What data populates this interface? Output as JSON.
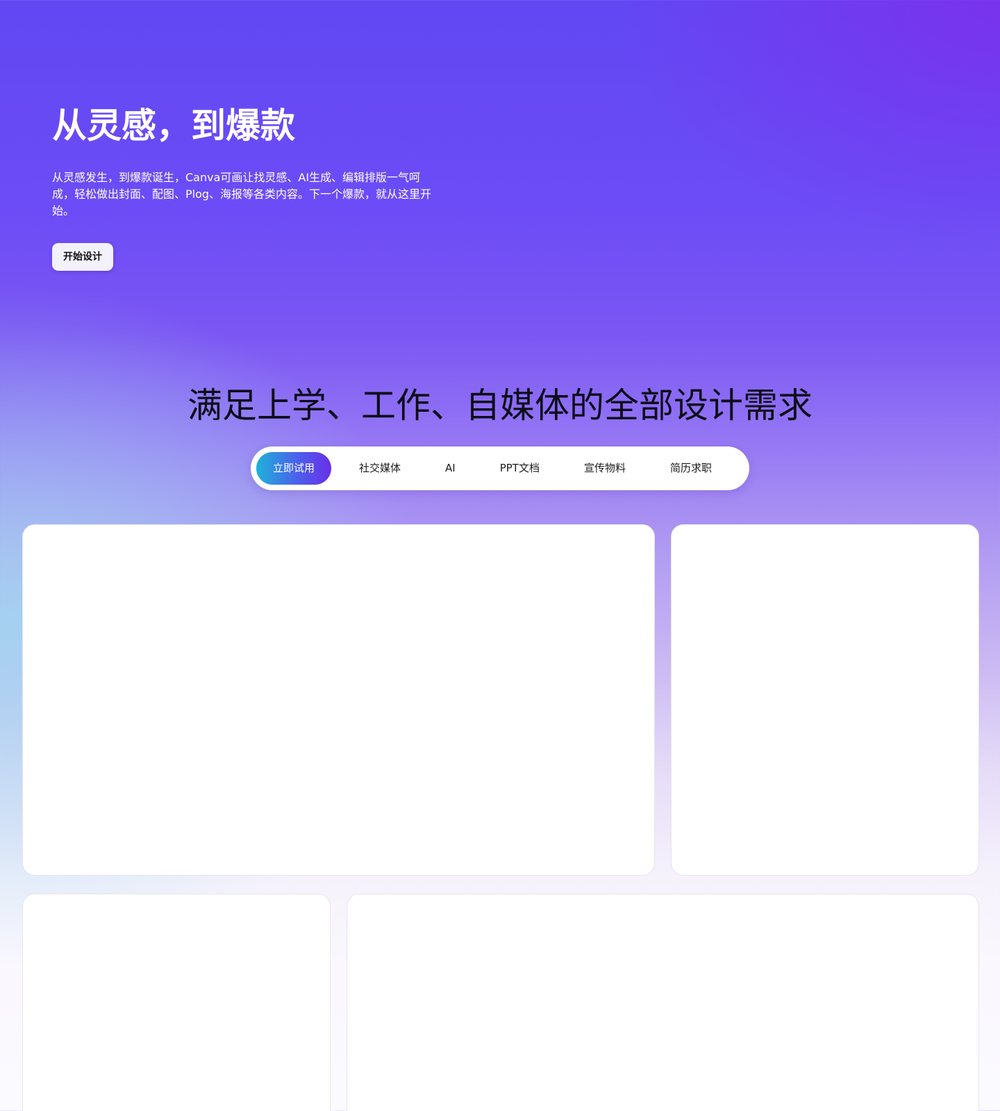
{
  "hero": {
    "title": "从灵感，到爆款",
    "subtitle": "从灵感发生，到爆款诞生，Canva可画让找灵感、AI生成、编辑排版一气呵成，轻松做出封面、配图、Plog、海报等各类内容。下一个爆款，就从这里开始。",
    "button_label": "开始设计"
  },
  "section": {
    "title": "满足上学、工作、自媒体的全部设计需求"
  },
  "tabs": [
    {
      "label": "立即试用",
      "active": true
    },
    {
      "label": "社交媒体",
      "active": false
    },
    {
      "label": "AI",
      "active": false
    },
    {
      "label": "PPT文档",
      "active": false
    },
    {
      "label": "宣传物料",
      "active": false
    },
    {
      "label": "简历求职",
      "active": false
    }
  ],
  "colors": {
    "tab_active_start": "#1fb1d9",
    "tab_active_end": "#6a2fe8",
    "hero_bg": "#6148f2"
  }
}
